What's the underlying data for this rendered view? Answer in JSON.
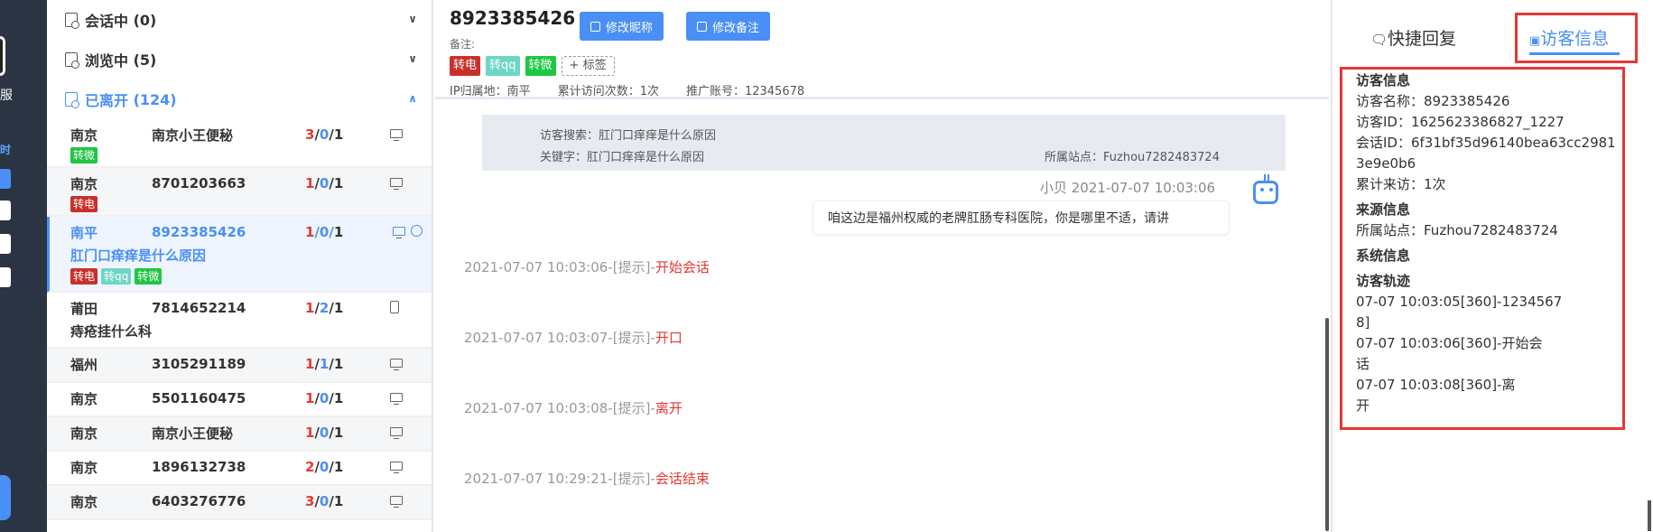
{
  "nav": {
    "text1": "服",
    "text2": "时"
  },
  "groups": [
    {
      "label": "会话中",
      "count": "(0)",
      "chevron": "∨"
    },
    {
      "label": "浏览中",
      "count": "(5)",
      "chevron": "∨"
    },
    {
      "label": "已离开",
      "count": "(124)",
      "chevron": "∧"
    }
  ],
  "rows": [
    {
      "city": "南京",
      "name": "南京小王便秘",
      "c1": "3",
      "c2": "0",
      "c3": "1",
      "sub": "",
      "tags": [
        "转微"
      ]
    },
    {
      "city": "南京",
      "name": "8701203663",
      "c1": "1",
      "c2": "0",
      "c3": "1",
      "sub": "",
      "tags": [
        "转电"
      ]
    },
    {
      "city": "南平",
      "name": "8923385426",
      "c1": "1",
      "c2": "0",
      "c3": "1",
      "sub": "肛门口痒痒是什么原因",
      "tags": [
        "转电",
        "转qq",
        "转微"
      ]
    },
    {
      "city": "莆田",
      "name": "7814652214",
      "c1": "1",
      "c2": "2",
      "c3": "1",
      "sub": "痔疮挂什么科",
      "tags": []
    },
    {
      "city": "福州",
      "name": "3105291189",
      "c1": "1",
      "c2": "1",
      "c3": "1",
      "sub": "",
      "tags": []
    },
    {
      "city": "南京",
      "name": "5501160475",
      "c1": "1",
      "c2": "0",
      "c3": "1",
      "sub": "",
      "tags": []
    },
    {
      "city": "南京",
      "name": "南京小王便秘",
      "c1": "1",
      "c2": "0",
      "c3": "1",
      "sub": "",
      "tags": []
    },
    {
      "city": "南京",
      "name": "1896132738",
      "c1": "2",
      "c2": "0",
      "c3": "1",
      "sub": "",
      "tags": []
    },
    {
      "city": "南京",
      "name": "6403276776",
      "c1": "3",
      "c2": "0",
      "c3": "1",
      "sub": "",
      "tags": []
    }
  ],
  "sep": "/",
  "chat": {
    "visitor_name": "8923385426",
    "btn_nickname": "修改昵称",
    "btn_remark": "修改备注",
    "note_label": "备注:",
    "tags": [
      "转电",
      "转qq",
      "转微"
    ],
    "add_tag": "+ 标签",
    "ip": "IP归属地：南平",
    "visits": "累计访问次数：1次",
    "promo": "推广账号：12345678",
    "search_text": "访客搜索：肛门口痒痒是什么原因",
    "keyword": "关键字：肛门口痒痒是什么原因",
    "site": "所属站点：Fuzhou7282483724",
    "agent_line": "小贝 2021-07-07 10:03:06",
    "agent_msg": "咱这边是福州权威的老牌肛肠专科医院，你是哪里不适，请讲",
    "system": [
      {
        "time": "2021-07-07 10:03:06-[提示]-",
        "event": "开始会话"
      },
      {
        "time": "2021-07-07 10:03:07-[提示]-",
        "event": "开口"
      },
      {
        "time": "2021-07-07 10:03:08-[提示]-",
        "event": "离开"
      },
      {
        "time": "2021-07-07 10:29:21-[提示]-",
        "event": "会话结束"
      }
    ]
  },
  "right": {
    "tab_quick": "快捷回复",
    "tab_visitor": "访客信息",
    "sec_visitor": "访客信息",
    "visitor_name": "访客名称：8923385426",
    "visitor_id": "访客ID：1625623386827_1227",
    "session_id_a": "会话ID：6f31bf35d96140bea63cc2981",
    "session_id_b": "3e9e0b6",
    "visits": "累计来访：1次",
    "sec_source": "来源信息",
    "site": "所属站点：Fuzhou7282483724",
    "sec_system": "系统信息",
    "sec_track": "访客轨迹",
    "track": [
      [
        "07-07 10:03:05[360]-1234567",
        "8]"
      ],
      [
        "07-07 10:03:06[360]-开始会",
        "话"
      ],
      [
        "07-07 10:03:08[360]-离",
        "开"
      ]
    ]
  }
}
